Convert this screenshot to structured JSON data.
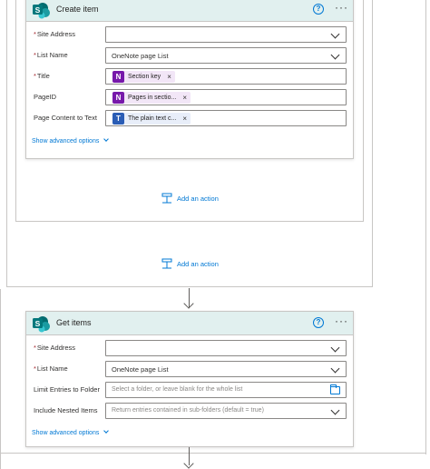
{
  "create_item": {
    "title": "Create item",
    "fields": [
      {
        "label": "Site Address",
        "required": true,
        "value": ""
      },
      {
        "label": "List Name",
        "required": true,
        "value": "OneNote page List"
      },
      {
        "label": "Title",
        "required": true,
        "token": "Section key"
      },
      {
        "label": "PageID",
        "required": false,
        "token": "Pages in sectio..."
      },
      {
        "label": "Page Content to Text",
        "required": false,
        "token": "The plain text c..."
      }
    ],
    "advanced_options": "Show advanced options"
  },
  "add_action_label": "Add an action",
  "get_items": {
    "title": "Get items",
    "fields": [
      {
        "label": "Site Address",
        "required": true,
        "value": ""
      },
      {
        "label": "List Name",
        "required": true,
        "value": "OneNote page List"
      },
      {
        "label": "Limit Entries to Folder",
        "required": false,
        "placeholder": "Select a folder, or leave blank for the whole list"
      },
      {
        "label": "Include Nested Items",
        "required": false,
        "placeholder": "Return entries contained in sub-folders (default = true)"
      }
    ],
    "advanced_options": "Show advanced options"
  },
  "icons": {
    "help": "help-circle-icon",
    "more": "more-options-icon",
    "onenote": "onenote-icon",
    "text": "text-icon",
    "folder": "folder-icon",
    "add": "add-action-icon",
    "sharepoint": "sharepoint-icon"
  },
  "colors": {
    "accent": "#0078d4",
    "header_bg": "#e1f0ef",
    "sharepoint": "#038387",
    "onenote": "#7719aa",
    "required": "#a4262c"
  }
}
